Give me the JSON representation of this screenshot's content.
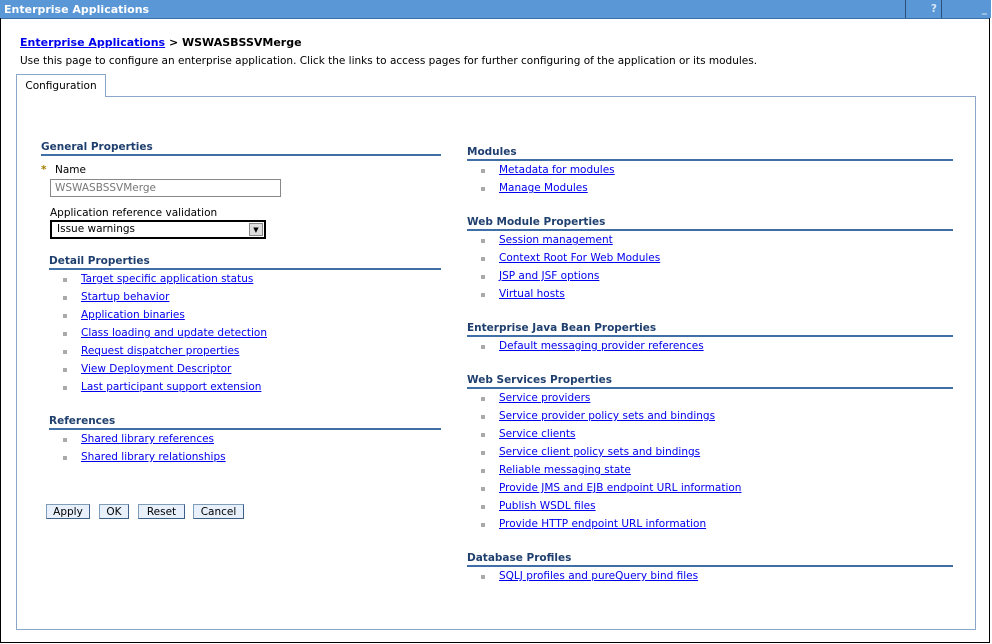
{
  "window": {
    "title": "Enterprise Applications",
    "help_label": "?",
    "minimize_label": "_"
  },
  "breadcrumb": {
    "parent": "Enterprise Applications",
    "separator": " > ",
    "current": "WSWASBSSVMerge"
  },
  "description": "Use this page to configure an enterprise application. Click the links to access pages for further configuring of the application or its modules.",
  "tab": {
    "label": "Configuration"
  },
  "general": {
    "heading": "General Properties",
    "required_marker": "*",
    "name_label": "Name",
    "name_value": "WSWASBSSVMerge",
    "validation_label": "Application reference validation",
    "validation_value": "Issue warnings"
  },
  "left_sections": [
    {
      "heading": "Detail Properties",
      "items": [
        "Target specific application status",
        "Startup behavior",
        "Application binaries",
        "Class loading and update detection",
        "Request dispatcher properties",
        "View Deployment Descriptor",
        "Last participant support extension"
      ]
    },
    {
      "heading": "References",
      "items": [
        "Shared library references",
        "Shared library relationships"
      ]
    }
  ],
  "right_sections": [
    {
      "heading": "Modules",
      "items": [
        "Metadata for modules",
        "Manage Modules"
      ]
    },
    {
      "heading": "Web Module Properties",
      "items": [
        "Session management",
        "Context Root For Web Modules",
        "JSP and JSF options",
        "Virtual hosts"
      ]
    },
    {
      "heading": "Enterprise Java Bean Properties",
      "items": [
        "Default messaging provider references"
      ]
    },
    {
      "heading": "Web Services Properties",
      "items": [
        "Service providers",
        "Service provider policy sets and bindings",
        "Service clients",
        "Service client policy sets and bindings",
        "Reliable messaging state",
        "Provide JMS and EJB endpoint URL information",
        "Publish WSDL files",
        "Provide HTTP endpoint URL information"
      ]
    },
    {
      "heading": "Database Profiles",
      "items": [
        "SQLJ profiles and pureQuery bind files"
      ]
    }
  ],
  "buttons": {
    "apply": "Apply",
    "ok": "OK",
    "reset": "Reset",
    "cancel": "Cancel"
  }
}
